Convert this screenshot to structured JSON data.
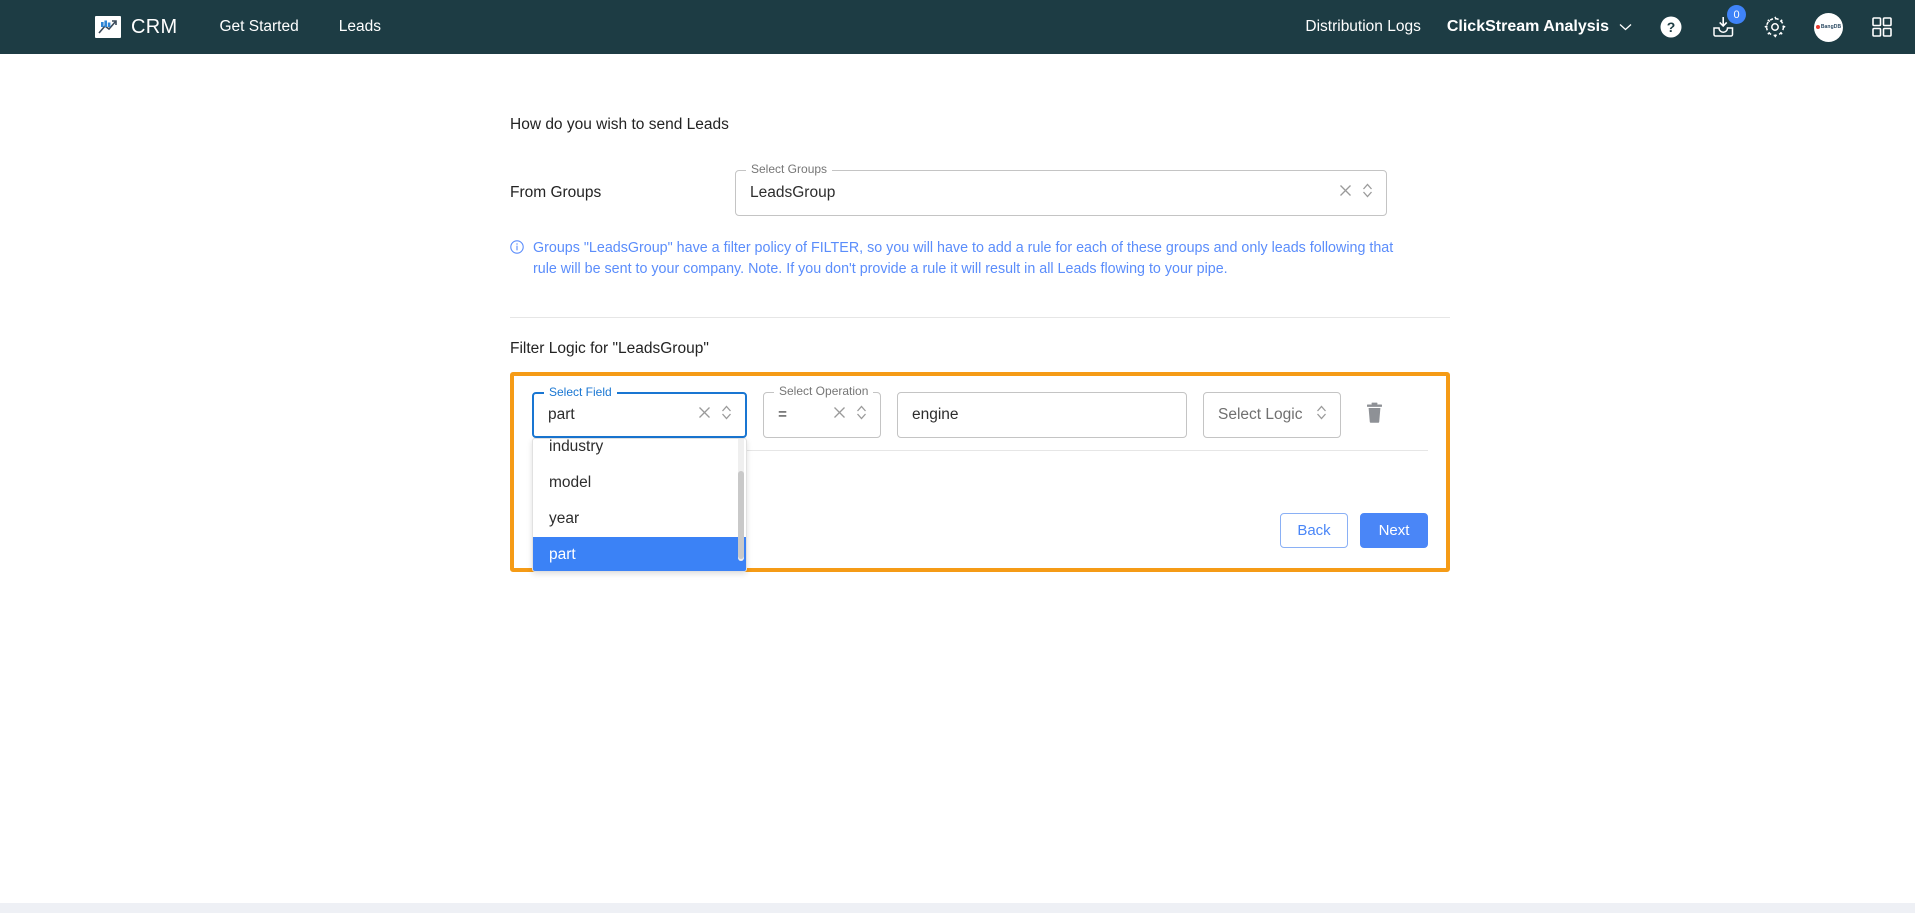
{
  "topbar": {
    "brand": "CRM",
    "brand_icon": "chart-trend-icon",
    "nav_links": [
      {
        "label": "Get Started",
        "name": "nav-get-started"
      },
      {
        "label": "Leads",
        "name": "nav-leads"
      }
    ],
    "right_links": [
      {
        "label": "Distribution Logs",
        "name": "nav-distribution-logs",
        "strong": false
      },
      {
        "label": "ClickStream Analysis",
        "name": "nav-clickstream-analysis",
        "strong": true
      }
    ],
    "icons": [
      {
        "name": "help-icon",
        "glyph": "?"
      },
      {
        "name": "inbox-download-icon",
        "badge": "0"
      },
      {
        "name": "gear-icon"
      },
      {
        "name": "avatar"
      },
      {
        "name": "apps-grid-icon"
      }
    ],
    "notification_count": "0",
    "avatar_label": "BangDB",
    "background": "#1d3c44"
  },
  "main": {
    "heading": "How do you wish to send Leads",
    "from_groups_label": "From Groups",
    "select_groups": {
      "legend": "Select Groups",
      "value": "LeadsGroup",
      "clear_icon": "clear-x-icon",
      "toggle_icon": "chevron-updown-icon"
    },
    "info": {
      "icon": "info-circle-icon",
      "text": "Groups \"LeadsGroup\" have a filter policy of FILTER, so you will have to add a rule for each of these groups and only leads following that rule will be sent to your company. Note. If you don't provide a rule it will result in all Leads flowing to your pipe.",
      "color": "#5b8dfb"
    },
    "filter_title": "Filter Logic for \"LeadsGroup\"",
    "highlight_color": "#f59b16"
  },
  "rule": {
    "field": {
      "legend": "Select Field",
      "value": "part",
      "clear_icon": "clear-x-icon",
      "toggle_icon": "chevron-updown-icon",
      "focused": true
    },
    "operation": {
      "legend": "Select Operation",
      "value": "=",
      "clear_icon": "clear-x-icon",
      "toggle_icon": "chevron-updown-icon"
    },
    "value_input": {
      "value": "engine",
      "placeholder": ""
    },
    "logic": {
      "value": "Select Logic",
      "toggle_icon": "chevron-updown-icon"
    },
    "delete_icon": "trash-icon",
    "dropdown": {
      "options": [
        {
          "label": "industry",
          "selected": false
        },
        {
          "label": "model",
          "selected": false
        },
        {
          "label": "year",
          "selected": false
        },
        {
          "label": "part",
          "selected": true
        }
      ],
      "selected_color": "#3b82f6"
    }
  },
  "actions": {
    "back_label": "Back",
    "next_label": "Next",
    "primary_color": "#4a86f7"
  }
}
